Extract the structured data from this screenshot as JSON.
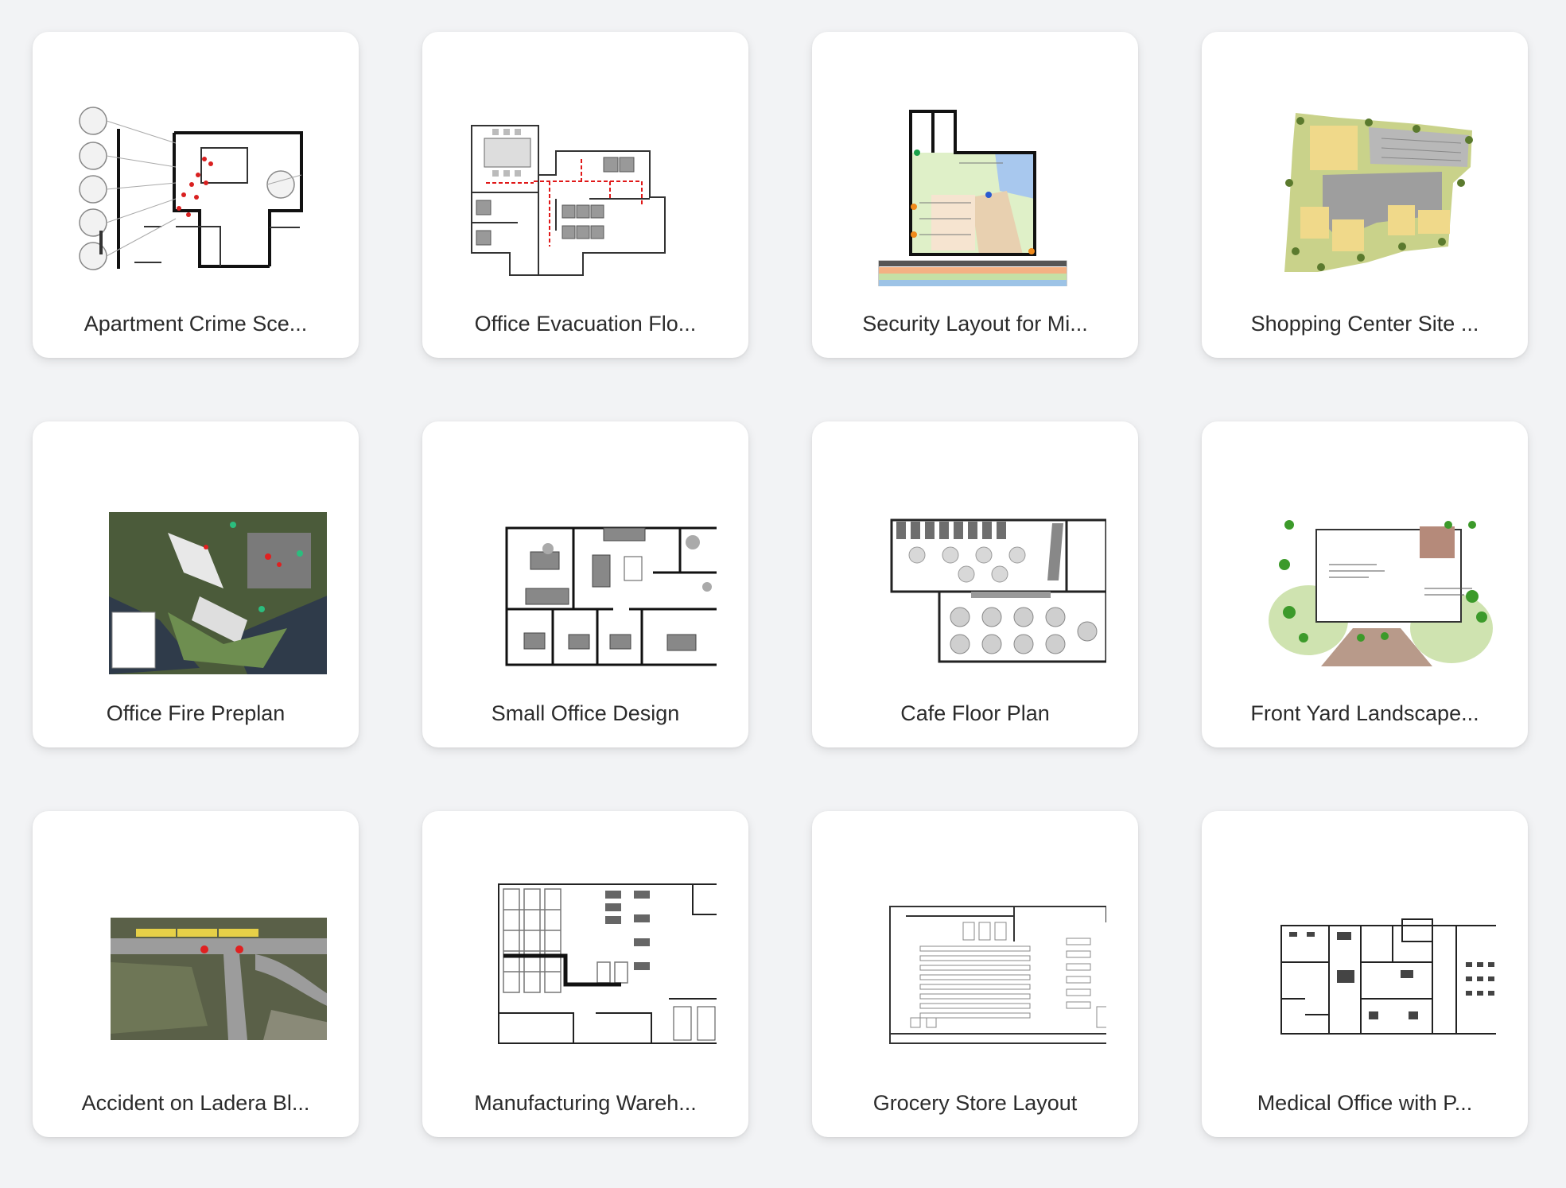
{
  "templates": [
    {
      "title": "Apartment Crime Sce...",
      "thumbnail": "crime-scene-floor-plan"
    },
    {
      "title": "Office Evacuation Flo...",
      "thumbnail": "evacuation-floor-plan"
    },
    {
      "title": "Security Layout for Mi...",
      "thumbnail": "security-layout-plan"
    },
    {
      "title": "Shopping Center Site ...",
      "thumbnail": "shopping-center-site-plan"
    },
    {
      "title": "Office Fire Preplan",
      "thumbnail": "fire-preplan-aerial"
    },
    {
      "title": "Small Office Design",
      "thumbnail": "small-office-floor-plan"
    },
    {
      "title": "Cafe Floor Plan",
      "thumbnail": "cafe-floor-plan"
    },
    {
      "title": "Front Yard Landscape...",
      "thumbnail": "landscape-plan"
    },
    {
      "title": "Accident on Ladera Bl...",
      "thumbnail": "accident-aerial-map"
    },
    {
      "title": "Manufacturing Wareh...",
      "thumbnail": "warehouse-layout"
    },
    {
      "title": "Grocery Store Layout",
      "thumbnail": "grocery-store-layout"
    },
    {
      "title": "Medical Office with P...",
      "thumbnail": "medical-office-floor-plan"
    }
  ]
}
